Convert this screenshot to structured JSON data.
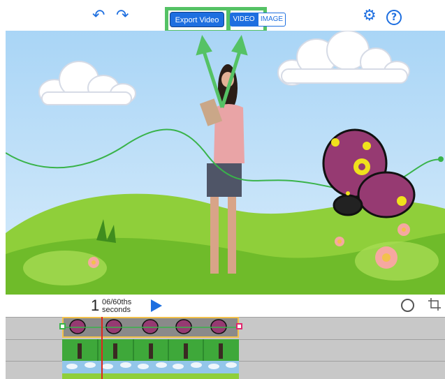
{
  "toolbar": {
    "undo_icon": "undo-icon",
    "redo_icon": "redo-icon",
    "export_label": "Export Video",
    "mode_video": "VIDEO",
    "mode_image": "IMAGE",
    "settings_icon": "gear-icon",
    "help_label": "?"
  },
  "timeline": {
    "frame_number": "1",
    "sub_frames": "06/60ths",
    "unit": "seconds"
  },
  "colors": {
    "accent": "#1e6fe0",
    "highlight": "#55c265",
    "playhead": "#e0261e"
  }
}
